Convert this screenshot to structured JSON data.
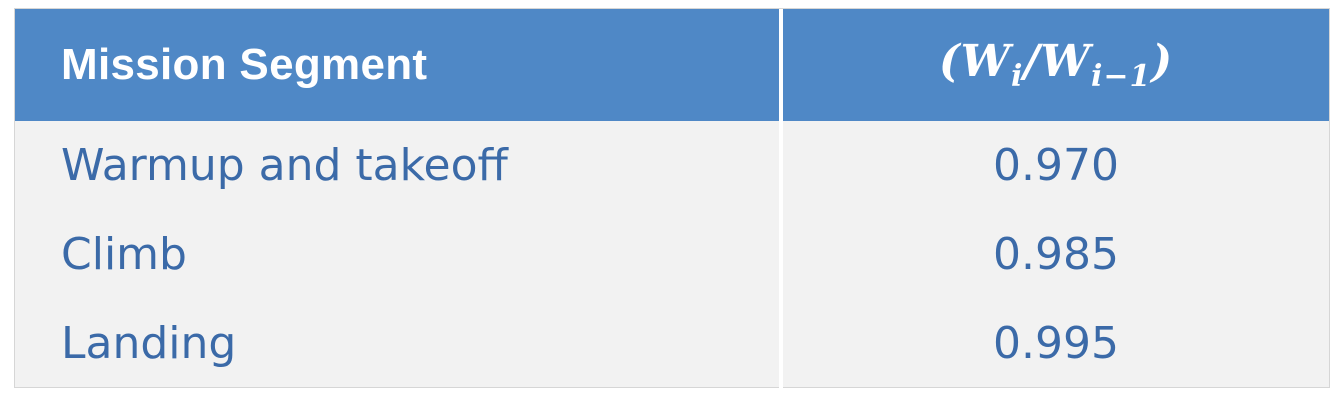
{
  "table": {
    "headers": {
      "segment": "Mission Segment",
      "ratio": "(W_i / W_{i−1})",
      "ratio_display": "(Wi/Wi−1)"
    },
    "rows": [
      {
        "segment": "Warmup and takeoff",
        "value": "0.970"
      },
      {
        "segment": "Climb",
        "value": "0.985"
      },
      {
        "segment": "Landing",
        "value": "0.995"
      }
    ]
  },
  "colors": {
    "header_bg": "#4f88c6",
    "header_text": "#ffffff",
    "body_bg": "#f2f2f2",
    "body_text": "#3b6aa8"
  }
}
